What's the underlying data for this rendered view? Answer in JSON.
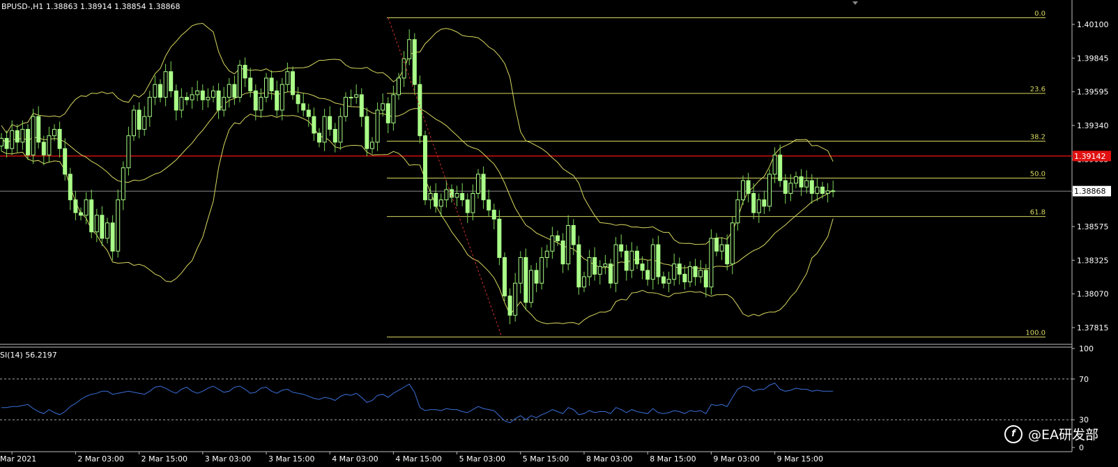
{
  "header": {
    "symbol": "BPUSD-,H1",
    "ohlc": "1.38863 1.38914 1.38854 1.38868"
  },
  "rsi_header": "SI(14) 56.2197",
  "price_axis": [
    "1.40100",
    "1.39845",
    "1.39595",
    "1.39340",
    "1.39085",
    "1.38830",
    "1.38575",
    "1.38325",
    "1.38070",
    "1.37815"
  ],
  "price_badges": {
    "red_line": "1.39142",
    "current": "1.38868"
  },
  "rsi_axis": [
    "100",
    "70",
    "30",
    "0"
  ],
  "time_axis": [
    "Mar 2021",
    "2 Mar 03:00",
    "2 Mar 15:00",
    "3 Mar 03:00",
    "3 Mar 15:00",
    "4 Mar 03:00",
    "4 Mar 15:00",
    "5 Mar 03:00",
    "5 Mar 15:00",
    "8 Mar 03:00",
    "8 Mar 15:00",
    "9 Mar 03:00",
    "9 Mar 15:00"
  ],
  "fibonacci": [
    "0.0",
    "23.6",
    "38.2",
    "50.0",
    "61.8",
    "100.0"
  ],
  "watermark": {
    "logo": "f",
    "text": "@EA研发部"
  },
  "colors": {
    "candle": "#aaff88",
    "wick": "#7ed957",
    "band": "#d8d860",
    "fib": "#d8d860",
    "red_line": "#e01010",
    "rsi": "#3a6fd8",
    "current_badge": "#ffffff"
  },
  "chart_data": {
    "type": "candlestick",
    "ylim": [
      1.3776,
      1.4025
    ],
    "fib_prices": [
      1.4022,
      1.3963,
      1.39258,
      1.3897,
      1.3867,
      1.3773
    ],
    "red_line_price": 1.39142,
    "current_price": 1.38868,
    "closes": [
      1.3928,
      1.392,
      1.3934,
      1.3925,
      1.3935,
      1.3915,
      1.3945,
      1.3925,
      1.3915,
      1.393,
      1.3935,
      1.392,
      1.39,
      1.388,
      1.387,
      1.3868,
      1.388,
      1.3855,
      1.3868,
      1.385,
      1.3862,
      1.384,
      1.388,
      1.3905,
      1.393,
      1.395,
      1.3935,
      1.3945,
      1.396,
      1.397,
      1.396,
      1.398,
      1.3965,
      1.395,
      1.396,
      1.3958,
      1.3962,
      1.3965,
      1.3958,
      1.396,
      1.3965,
      1.395,
      1.396,
      1.397,
      1.396,
      1.3985,
      1.3975,
      1.3965,
      1.395,
      1.396,
      1.3975,
      1.3965,
      1.395,
      1.397,
      1.398,
      1.3962,
      1.3955,
      1.395,
      1.3945,
      1.3932,
      1.3925,
      1.3945,
      1.3935,
      1.3925,
      1.3945,
      1.396,
      1.396,
      1.3962,
      1.3945,
      1.392,
      1.3925,
      1.395,
      1.3955,
      1.394,
      1.3962,
      1.3975,
      1.399,
      1.4005,
      1.397,
      1.393,
      1.388,
      1.3885,
      1.3875,
      1.388,
      1.3888,
      1.3882,
      1.3885,
      1.388,
      1.387,
      1.3885,
      1.39,
      1.388,
      1.3872,
      1.3865,
      1.3835,
      1.3805,
      1.379,
      1.3815,
      1.3835,
      1.38,
      1.3825,
      1.3815,
      1.3835,
      1.384,
      1.3852,
      1.3848,
      1.383,
      1.386,
      1.3845,
      1.3812,
      1.382,
      1.3835,
      1.3822,
      1.3828,
      1.383,
      1.3815,
      1.3845,
      1.384,
      1.3825,
      1.384,
      1.383,
      1.3825,
      1.3818,
      1.3845,
      1.382,
      1.3815,
      1.3818,
      1.383,
      1.3822,
      1.3816,
      1.3828,
      1.382,
      1.3825,
      1.3812,
      1.385,
      1.384,
      1.3845,
      1.383,
      1.3862,
      1.388,
      1.3895,
      1.3885,
      1.387,
      1.388,
      1.3875,
      1.39,
      1.3915,
      1.3895,
      1.3885,
      1.3893,
      1.3898,
      1.389,
      1.3895,
      1.3885,
      1.389,
      1.3885,
      1.3887,
      1.3887
    ],
    "rsi_values": [
      42,
      42,
      43,
      43,
      44,
      45,
      41,
      38,
      36,
      40,
      37,
      35,
      38,
      43,
      46,
      50,
      53,
      55,
      56,
      58,
      58,
      55,
      56,
      57,
      58,
      57,
      56,
      55,
      58,
      62,
      63,
      61,
      58,
      56,
      60,
      62,
      58,
      56,
      58,
      61,
      63,
      60,
      57,
      58,
      62,
      63,
      60,
      56,
      57,
      61,
      62,
      58,
      56,
      59,
      60,
      57,
      56,
      55,
      53,
      51,
      50,
      52,
      51,
      49,
      53,
      55,
      54,
      56,
      52,
      47,
      49,
      54,
      55,
      52,
      56,
      59,
      62,
      65,
      57,
      42,
      39,
      40,
      40,
      39,
      41,
      40,
      40,
      38,
      37,
      40,
      43,
      41,
      40,
      39,
      34,
      29,
      27,
      31,
      34,
      30,
      34,
      32,
      35,
      37,
      40,
      38,
      36,
      42,
      40,
      35,
      36,
      39,
      37,
      38,
      38,
      36,
      42,
      40,
      37,
      40,
      38,
      37,
      36,
      41,
      37,
      36,
      37,
      39,
      38,
      36,
      39,
      38,
      39,
      36,
      45,
      44,
      45,
      43,
      52,
      60,
      63,
      62,
      58,
      60,
      60,
      64,
      66,
      60,
      58,
      59,
      61,
      60,
      60,
      58,
      59,
      58,
      58,
      58
    ]
  }
}
